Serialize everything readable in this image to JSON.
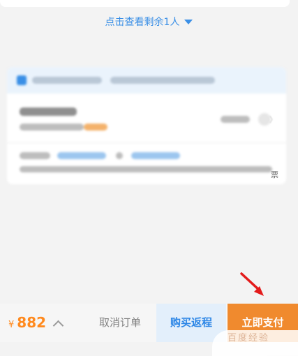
{
  "list": {
    "view_more_label": "点击查看剩余1人",
    "view_more_icon": "caret-down-icon"
  },
  "info_card": {
    "side_mark": "〉",
    "receipt_label": "票"
  },
  "bottom_bar": {
    "currency": "¥",
    "price": "882",
    "price_toggle_icon": "chevron-up-icon",
    "cancel_label": "取消订单",
    "return_label": "购买返程",
    "pay_label": "立即支付"
  },
  "annotation": {
    "arrow_icon": "red-arrow-icon"
  },
  "watermark": {
    "text": "百度经验"
  },
  "colors": {
    "accent": "#3a8fe6",
    "price": "#ff8a1f",
    "pay_button": "#f08a2e",
    "return_button_bg": "#e3effb",
    "annotation": "#e31b1b"
  }
}
